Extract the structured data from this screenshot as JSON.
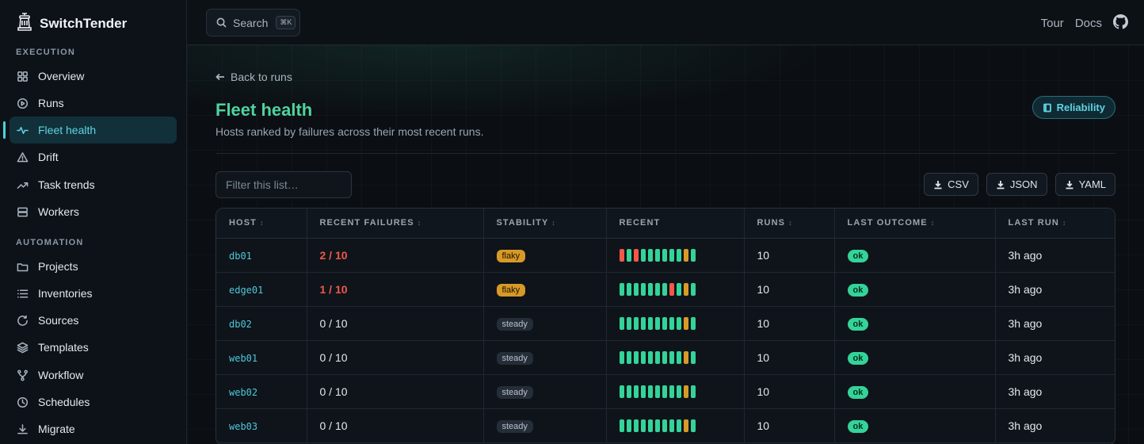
{
  "app": {
    "name": "SwitchTender"
  },
  "sidebar": {
    "sections": [
      {
        "label": "EXECUTION",
        "items": [
          {
            "label": "Overview",
            "icon": "grid-icon"
          },
          {
            "label": "Runs",
            "icon": "play-circle-icon"
          },
          {
            "label": "Fleet health",
            "icon": "pulse-icon",
            "active": true
          },
          {
            "label": "Drift",
            "icon": "warning-triangle-icon"
          },
          {
            "label": "Task trends",
            "icon": "trending-up-icon"
          },
          {
            "label": "Workers",
            "icon": "server-icon"
          }
        ]
      },
      {
        "label": "AUTOMATION",
        "items": [
          {
            "label": "Projects",
            "icon": "folder-icon"
          },
          {
            "label": "Inventories",
            "icon": "list-icon"
          },
          {
            "label": "Sources",
            "icon": "refresh-icon"
          },
          {
            "label": "Templates",
            "icon": "layers-icon"
          },
          {
            "label": "Workflow",
            "icon": "branch-icon"
          },
          {
            "label": "Schedules",
            "icon": "clock-icon"
          },
          {
            "label": "Migrate",
            "icon": "download-icon"
          }
        ]
      }
    ]
  },
  "topbar": {
    "search_label": "Search",
    "search_shortcut": "⌘K",
    "links": [
      "Tour",
      "Docs"
    ]
  },
  "page": {
    "back_label": "Back to runs",
    "title": "Fleet health",
    "subtitle": "Hosts ranked by failures across their most recent runs.",
    "reliability_label": "Reliability",
    "filter_placeholder": "Filter this list…",
    "exports": [
      "CSV",
      "JSON",
      "YAML"
    ]
  },
  "table": {
    "columns": [
      "HOST",
      "RECENT FAILURES",
      "STABILITY",
      "RECENT",
      "RUNS",
      "LAST OUTCOME",
      "LAST RUN"
    ],
    "sortable": [
      true,
      true,
      true,
      false,
      true,
      true,
      true
    ],
    "rows": [
      {
        "host": "db01",
        "failures": "2 / 10",
        "failing": true,
        "stability": "flaky",
        "recent": [
          "fail",
          "ok",
          "fail",
          "ok",
          "ok",
          "ok",
          "ok",
          "ok",
          "ok",
          "warn",
          "ok"
        ],
        "runs": "10",
        "outcome": "ok",
        "last_run": "3h ago"
      },
      {
        "host": "edge01",
        "failures": "1 / 10",
        "failing": true,
        "stability": "flaky",
        "recent": [
          "ok",
          "ok",
          "ok",
          "ok",
          "ok",
          "ok",
          "ok",
          "fail",
          "ok",
          "warn",
          "ok"
        ],
        "runs": "10",
        "outcome": "ok",
        "last_run": "3h ago"
      },
      {
        "host": "db02",
        "failures": "0 / 10",
        "failing": false,
        "stability": "steady",
        "recent": [
          "ok",
          "ok",
          "ok",
          "ok",
          "ok",
          "ok",
          "ok",
          "ok",
          "ok",
          "warn",
          "ok"
        ],
        "runs": "10",
        "outcome": "ok",
        "last_run": "3h ago"
      },
      {
        "host": "web01",
        "failures": "0 / 10",
        "failing": false,
        "stability": "steady",
        "recent": [
          "ok",
          "ok",
          "ok",
          "ok",
          "ok",
          "ok",
          "ok",
          "ok",
          "ok",
          "warn",
          "ok"
        ],
        "runs": "10",
        "outcome": "ok",
        "last_run": "3h ago"
      },
      {
        "host": "web02",
        "failures": "0 / 10",
        "failing": false,
        "stability": "steady",
        "recent": [
          "ok",
          "ok",
          "ok",
          "ok",
          "ok",
          "ok",
          "ok",
          "ok",
          "ok",
          "warn",
          "ok"
        ],
        "runs": "10",
        "outcome": "ok",
        "last_run": "3h ago"
      },
      {
        "host": "web03",
        "failures": "0 / 10",
        "failing": false,
        "stability": "steady",
        "recent": [
          "ok",
          "ok",
          "ok",
          "ok",
          "ok",
          "ok",
          "ok",
          "ok",
          "ok",
          "warn",
          "ok"
        ],
        "runs": "10",
        "outcome": "ok",
        "last_run": "3h ago"
      }
    ]
  },
  "colors": {
    "accent": "#4fd39c",
    "accent_cyan": "#5fd4e3",
    "status_ok": "#34d399",
    "status_fail": "#f0584a",
    "status_warn": "#d89a26"
  }
}
